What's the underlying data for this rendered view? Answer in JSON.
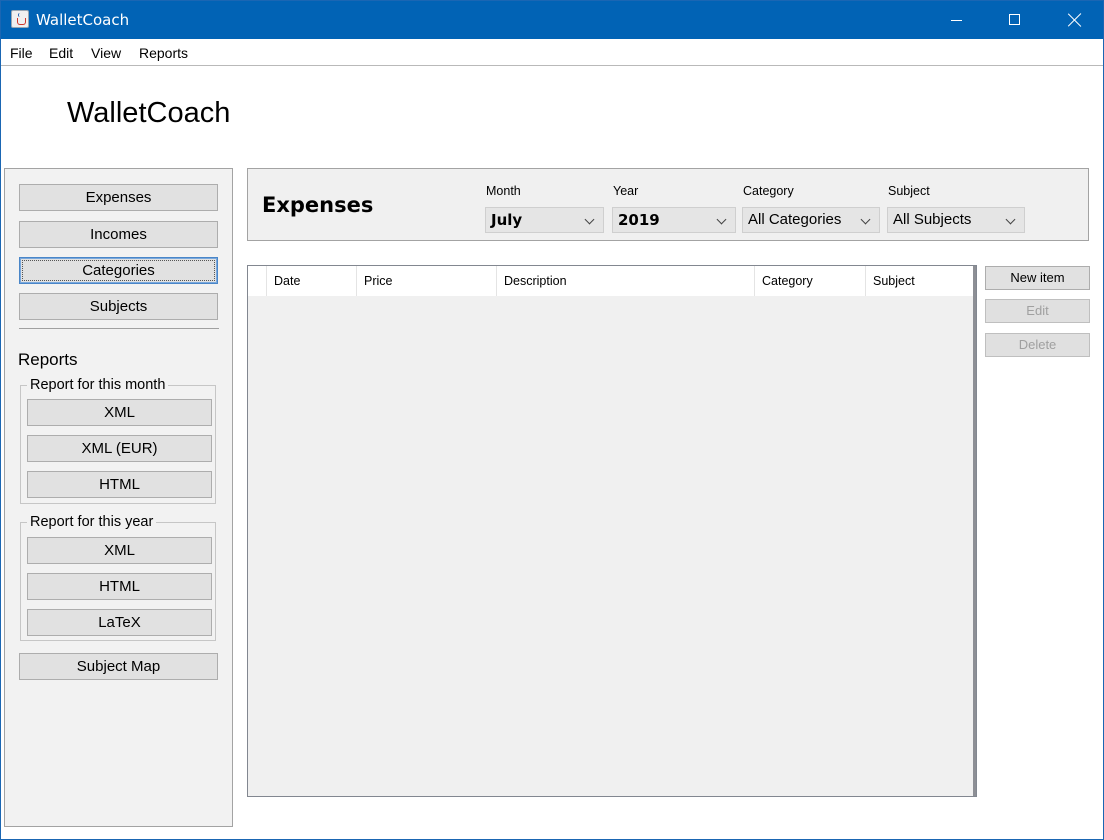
{
  "window": {
    "title": "WalletCoach"
  },
  "menu": {
    "items": [
      "File",
      "Edit",
      "View",
      "Reports"
    ]
  },
  "app_heading": "WalletCoach",
  "sidebar": {
    "nav": [
      "Expenses",
      "Incomes",
      "Categories",
      "Subjects"
    ],
    "reports_label": "Reports",
    "month_group": {
      "title": "Report for this month",
      "buttons": [
        "XML",
        "XML (EUR)",
        "HTML"
      ]
    },
    "year_group": {
      "title": "Report for this year",
      "buttons": [
        "XML",
        "HTML",
        "LaTeX"
      ]
    },
    "subject_map": "Subject Map"
  },
  "filters": {
    "title": "Expenses",
    "month": {
      "label": "Month",
      "value": "July"
    },
    "year": {
      "label": "Year",
      "value": "2019"
    },
    "category": {
      "label": "Category",
      "value": "All Categories"
    },
    "subject": {
      "label": "Subject",
      "value": "All Subjects"
    }
  },
  "table": {
    "columns": [
      "Date",
      "Price",
      "Description",
      "Category",
      "Subject"
    ]
  },
  "actions": {
    "new_item": "New item",
    "edit": "Edit",
    "delete": "Delete"
  },
  "colors": {
    "titlebar": "#0163b5",
    "focus": "#4a86c8"
  }
}
